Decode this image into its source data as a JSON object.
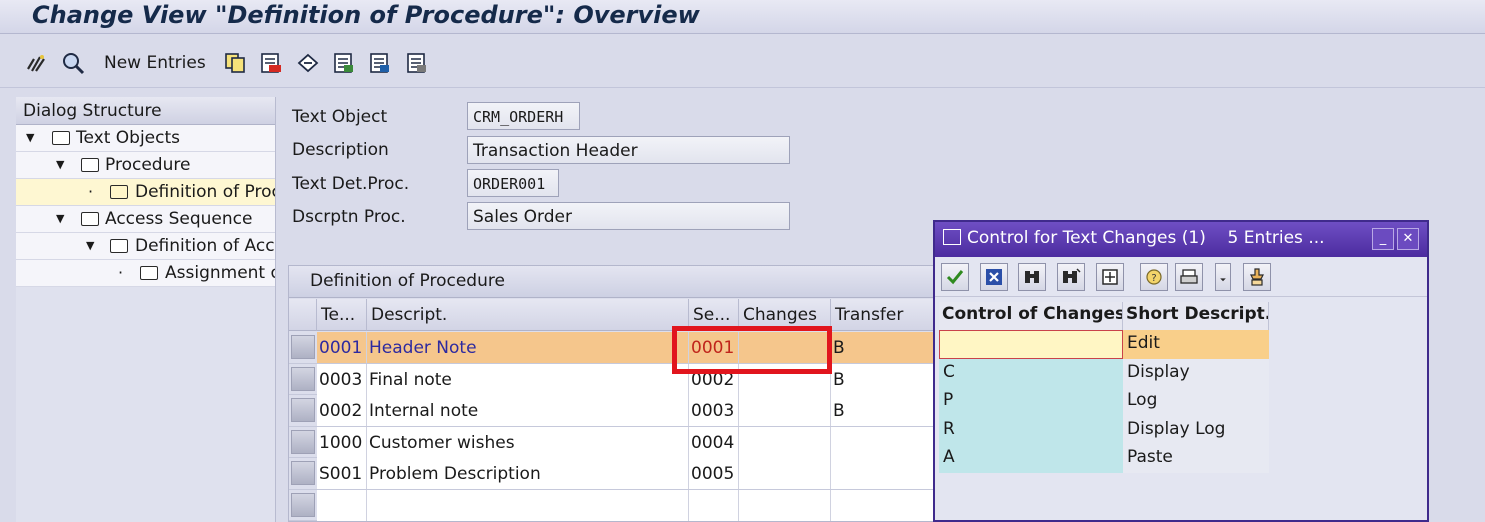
{
  "window": {
    "title": "Change View \"Definition of Procedure\": Overview"
  },
  "toolbar": {
    "new_entries_label": "New Entries"
  },
  "dialog_structure": {
    "header": "Dialog Structure",
    "items": [
      {
        "label": "Text Objects"
      },
      {
        "label": "Procedure"
      },
      {
        "label": "Definition of Proc"
      },
      {
        "label": "Access Sequence"
      },
      {
        "label": "Definition of Acce"
      },
      {
        "label": "Assignment o"
      }
    ]
  },
  "header_form": {
    "text_object_label": "Text Object",
    "text_object_value": "CRM_ORDERH",
    "description_label": "Description",
    "description_value": "Transaction Header",
    "text_det_proc_label": "Text Det.Proc.",
    "text_det_proc_value": "ORDER001",
    "dscrptn_proc_label": "Dscrptn Proc.",
    "dscrptn_proc_value": "Sales Order"
  },
  "table": {
    "title": "Definition of Procedure",
    "columns": [
      "Te...",
      "Descript.",
      "Se...",
      "Changes",
      "Transfer"
    ],
    "rows": [
      {
        "code": "0001",
        "desc": "Header Note",
        "seq": "0001",
        "changes": "",
        "transfer": "B"
      },
      {
        "code": "0003",
        "desc": "Final note",
        "seq": "0002",
        "changes": "",
        "transfer": "B"
      },
      {
        "code": "0002",
        "desc": "Internal note",
        "seq": "0003",
        "changes": "",
        "transfer": "B"
      },
      {
        "code": "1000",
        "desc": "Customer wishes",
        "seq": "0004",
        "changes": "",
        "transfer": ""
      },
      {
        "code": "S001",
        "desc": "Problem Description",
        "seq": "0005",
        "changes": "",
        "transfer": ""
      }
    ]
  },
  "popup": {
    "title": "Control for Text Changes (1)",
    "entries": "5 Entries ...",
    "col_control": "Control of Changes",
    "col_short": "Short Descript.",
    "rows": [
      {
        "key": "",
        "value": "Edit"
      },
      {
        "key": "C",
        "value": "Display"
      },
      {
        "key": "P",
        "value": "Log"
      },
      {
        "key": "R",
        "value": "Display Log"
      },
      {
        "key": "A",
        "value": "Paste"
      }
    ]
  },
  "colors": {
    "popup_title": "#4c2c9f",
    "highlight_row": "#f5c68c",
    "red_box": "#e1151d",
    "key_cells": "#bfe6ea"
  }
}
